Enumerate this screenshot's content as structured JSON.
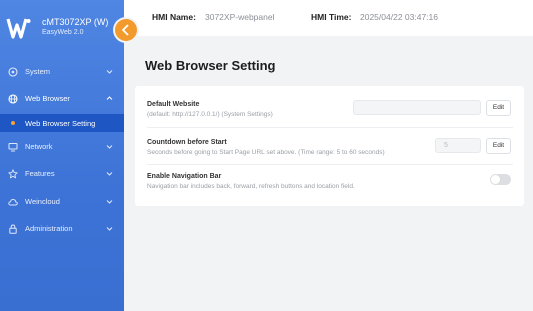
{
  "colors": {
    "sidebar": "#4a80df",
    "active_item": "#1e56c4",
    "accent": "#f39a2d"
  },
  "brand": {
    "logo_letter": "W",
    "title": "cMT3072XP (W)",
    "subtitle": "EasyWeb 2.0"
  },
  "sidebar": {
    "items": [
      {
        "label": "System",
        "icon": "gear-icon"
      },
      {
        "label": "Web Browser",
        "icon": "globe-icon"
      },
      {
        "label": "Network",
        "icon": "monitor-icon"
      },
      {
        "label": "Features",
        "icon": "star-icon"
      },
      {
        "label": "Weincloud",
        "icon": "cloud-icon"
      },
      {
        "label": "Administration",
        "icon": "lock-icon"
      }
    ],
    "active_sub": {
      "label": "Web Browser Setting"
    }
  },
  "header": {
    "hmi_name_label": "HMI Name:",
    "hmi_name_value": "3072XP-webpanel",
    "hmi_time_label": "HMI Time:",
    "hmi_time_value": "2025/04/22 03:47:16"
  },
  "main": {
    "title": "Web Browser Setting",
    "default_website": {
      "title": "Default Website",
      "desc": "(default: http://127.0.0.1/) (System Settings)",
      "value": "",
      "edit": "Edit"
    },
    "countdown": {
      "title": "Countdown before Start",
      "desc": "Seconds before going to Start Page URL set above. (Time range: 5 to 60 seconds)",
      "value": "5",
      "edit": "Edit"
    },
    "navigation_bar": {
      "title": "Enable Navigation Bar",
      "desc": "Navigation bar includes back, forward, refresh buttons and location field.",
      "enabled": false
    }
  }
}
